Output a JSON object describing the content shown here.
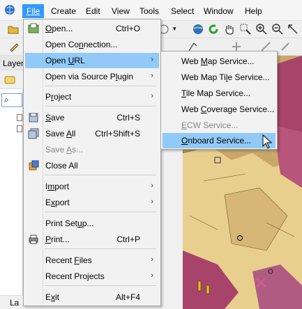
{
  "menubar": {
    "items": [
      "File",
      "Create",
      "Edit",
      "View",
      "Tools",
      "Select",
      "Window",
      "Help"
    ],
    "active": "File"
  },
  "layers_panel": {
    "title": "Layer",
    "status": "La"
  },
  "file_menu": {
    "items": [
      {
        "label": "Open...",
        "shortcut": "Ctrl+O",
        "icon": "open-folder-icon"
      },
      {
        "label": "Open Connection...",
        "shortcut": ""
      },
      {
        "label": "Open URL",
        "shortcut": "",
        "submenu": true,
        "highlighted": true
      },
      {
        "label": "Open via Source Plugin",
        "shortcut": "",
        "submenu": true
      },
      {
        "label": "Project",
        "shortcut": "",
        "submenu": true
      },
      {
        "label": "Save",
        "shortcut": "Ctrl+S",
        "icon": "save-icon"
      },
      {
        "label": "Save All",
        "shortcut": "Ctrl+Shift+S",
        "icon": "save-all-icon"
      },
      {
        "label": "Save As...",
        "shortcut": "",
        "disabled": true
      },
      {
        "label": "Close All",
        "shortcut": "",
        "icon": "close-all-icon"
      },
      {
        "label": "Import",
        "shortcut": "",
        "submenu": true
      },
      {
        "label": "Export",
        "shortcut": "",
        "submenu": true
      },
      {
        "label": "Print Setup...",
        "shortcut": ""
      },
      {
        "label": "Print...",
        "shortcut": "Ctrl+P",
        "icon": "printer-icon"
      },
      {
        "label": "Recent Files",
        "shortcut": "",
        "submenu": true
      },
      {
        "label": "Recent Projects",
        "shortcut": "",
        "submenu": true
      },
      {
        "label": "Exit",
        "shortcut": "Alt+F4"
      }
    ]
  },
  "open_url_submenu": {
    "items": [
      {
        "label": "Web Map Service..."
      },
      {
        "label": "Web Map Tile Service..."
      },
      {
        "label": "Tile Map Service..."
      },
      {
        "label": "Web Coverage Service..."
      },
      {
        "label": "ECW Service...",
        "disabled": true
      },
      {
        "label": "Onboard Service...",
        "highlighted": true
      }
    ]
  },
  "colors": {
    "menu_highlight": "#91c9f7",
    "menubar_active": "#3399ff",
    "map_land": "#c7a86a",
    "map_sea": "#a8446a"
  }
}
